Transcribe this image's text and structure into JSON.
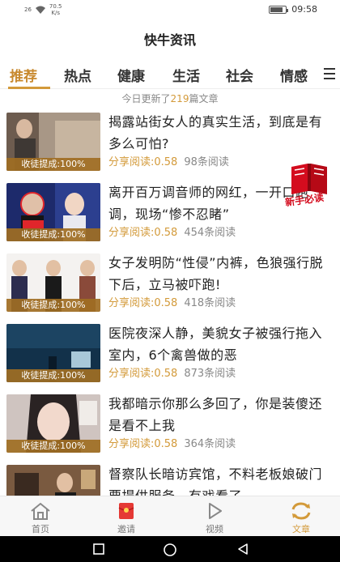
{
  "status_bar": {
    "signal": "26",
    "speed_value": "70.5",
    "speed_unit": "K/s",
    "battery_level": 0.85,
    "time": "09:58"
  },
  "app": {
    "title": "快牛资讯"
  },
  "tabs": [
    "推荐",
    "热点",
    "健康",
    "生活",
    "社会",
    "情感"
  ],
  "tabs_more_icon": "menu-icon",
  "update_notice": {
    "prefix": "今日更新了",
    "count": "219",
    "suffix": "篇文章"
  },
  "badge_text": "收徒提成:100%",
  "articles": [
    {
      "title": "揭露站街女人的真实生活，到底是有多么可怕?",
      "share": "分享阅读:0.58",
      "reads": "98条阅读"
    },
    {
      "title": "离开百万调音师的网红，一开口跑调，现场“惨不忍睹”",
      "share": "分享阅读:0.58",
      "reads": "454条阅读"
    },
    {
      "title": "女子发明防“性侵”内裤，色狼强行脱下后，立马被吓跑!",
      "share": "分享阅读:0.58",
      "reads": "418条阅读"
    },
    {
      "title": "医院夜深人静，美貌女子被强行拖入室内，6个禽兽做的恶",
      "share": "分享阅读:0.58",
      "reads": "873条阅读"
    },
    {
      "title": "我都暗示你那么多回了，你是装傻还是看不上我",
      "share": "分享阅读:0.58",
      "reads": "364条阅读"
    },
    {
      "title": "督察队长暗访宾馆，不料老板娘破门要提供服务，有戏看了",
      "share": "",
      "reads": ""
    }
  ],
  "newbie_badge": {
    "label": "新手必读",
    "icon": "book-icon"
  },
  "bottom_nav": [
    {
      "label": "首页",
      "icon": "home-icon"
    },
    {
      "label": "邀请",
      "icon": "red-envelope-icon"
    },
    {
      "label": "视频",
      "icon": "play-icon"
    },
    {
      "label": "文章",
      "icon": "refresh-icon"
    }
  ],
  "colors": {
    "accent": "#d39a3a",
    "badge_bg": "#a06e23",
    "newbie_red": "#d40c1e"
  }
}
